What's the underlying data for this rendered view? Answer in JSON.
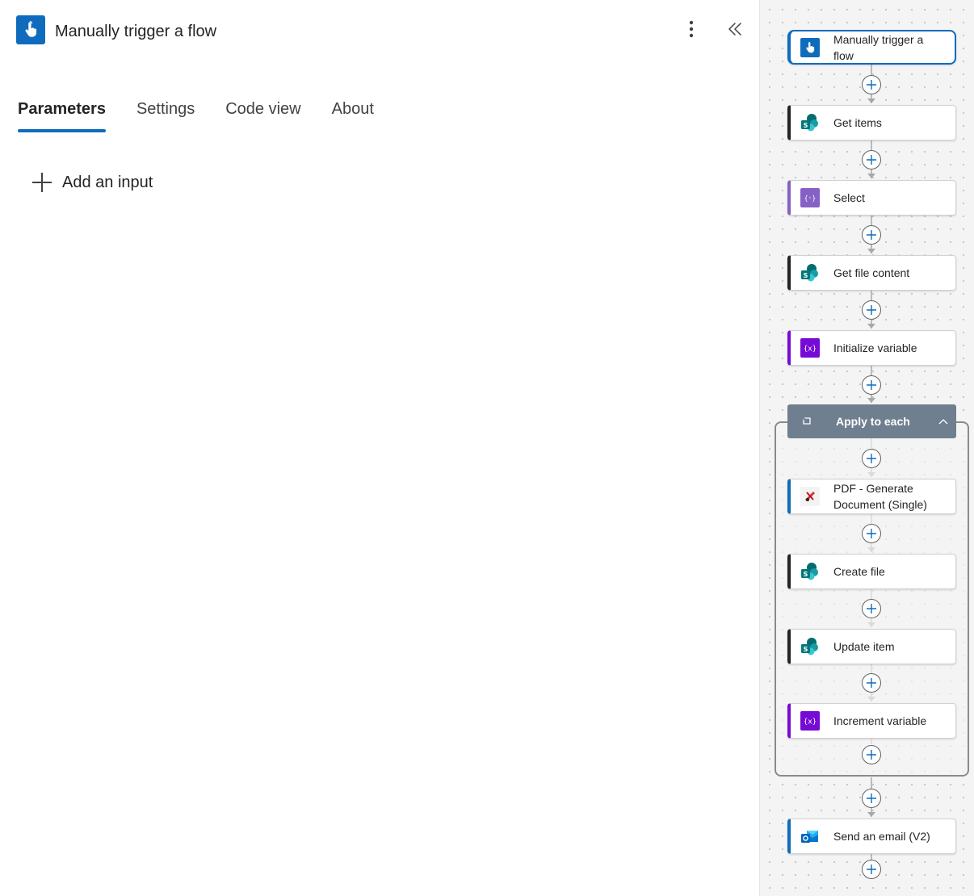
{
  "header": {
    "title": "Manually trigger a flow",
    "icon": "hand-touch-icon",
    "accent_color": "#0f6cbd"
  },
  "tabs": [
    {
      "label": "Parameters",
      "active": true
    },
    {
      "label": "Settings",
      "active": false
    },
    {
      "label": "Code view",
      "active": false
    },
    {
      "label": "About",
      "active": false
    }
  ],
  "parameters": {
    "add_input_label": "Add an input"
  },
  "flow": {
    "nodes": [
      {
        "label": "Manually trigger a",
        "label2": "flow",
        "icon": "hand-touch-icon",
        "color": "#0f6cbd",
        "selected": true
      },
      {
        "label": "Get items",
        "icon": "sharepoint-icon",
        "color": "#242424"
      },
      {
        "label": "Select",
        "icon": "data-operation-icon",
        "color": "#8661c5"
      },
      {
        "label": "Get file content",
        "icon": "sharepoint-icon",
        "color": "#242424"
      },
      {
        "label": "Initialize variable",
        "icon": "variable-icon",
        "color": "#770bd6"
      },
      {
        "label": "PDF - Generate",
        "label2": "Document (Single)",
        "icon": "pdf-tool-icon",
        "color": "#0f6cbd"
      },
      {
        "label": "Create file",
        "icon": "sharepoint-icon",
        "color": "#242424"
      },
      {
        "label": "Update item",
        "icon": "sharepoint-icon",
        "color": "#242424"
      },
      {
        "label": "Increment variable",
        "icon": "variable-icon",
        "color": "#770bd6"
      },
      {
        "label": "Send an email (V2)",
        "icon": "outlook-icon",
        "color": "#0f6cbd"
      }
    ],
    "loop": {
      "label": "Apply to each",
      "icon": "loop-icon",
      "color": "#6f7f90"
    }
  }
}
